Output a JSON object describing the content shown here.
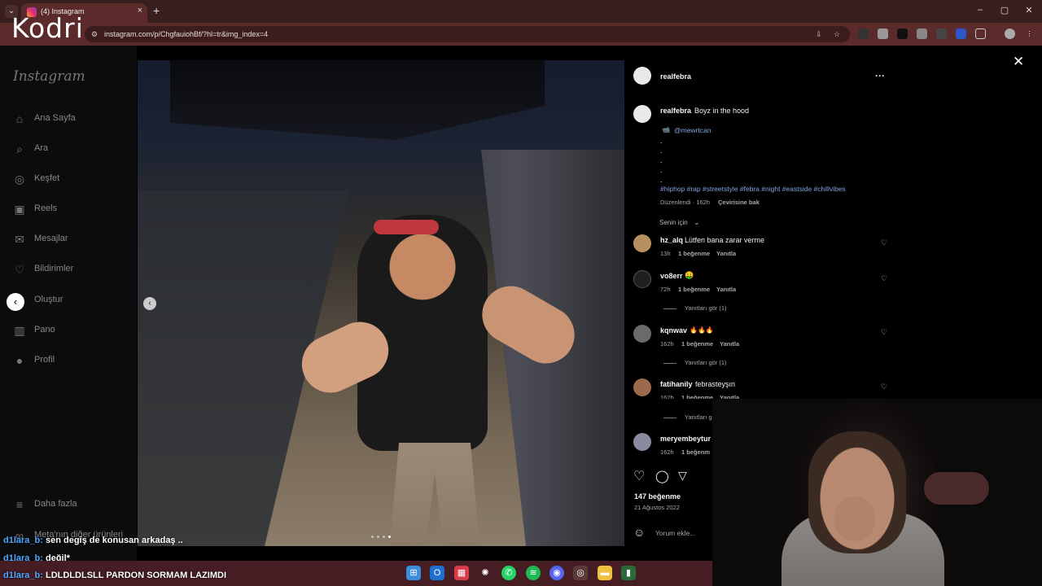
{
  "browser": {
    "tab_title": "(4) Instagram",
    "tab_close": "×",
    "new_tab": "+",
    "url": "instagram.com/p/ChgfauiohBf/?hl=tr&img_index=4",
    "window_buttons": [
      "–",
      "▢",
      "✕"
    ]
  },
  "stream_brand": "Kodri",
  "sidebar": {
    "logo": "Instagram",
    "items": [
      {
        "label": "Ana Sayfa",
        "icon": "home-icon"
      },
      {
        "label": "Ara",
        "icon": "search-icon"
      },
      {
        "label": "Keşfet",
        "icon": "compass-icon"
      },
      {
        "label": "Reels",
        "icon": "reels-icon"
      },
      {
        "label": "Mesajlar",
        "icon": "messenger-icon"
      },
      {
        "label": "Bildirimler",
        "icon": "heart-icon"
      },
      {
        "label": "Oluştur",
        "icon": "plus-square-icon"
      },
      {
        "label": "Pano",
        "icon": "dashboard-icon"
      },
      {
        "label": "Profil",
        "icon": "profile-icon"
      }
    ],
    "more": "Daha fazla",
    "meta_more": "Meta'nın diğer ürünleri"
  },
  "post": {
    "author": "realfebra",
    "more_icon": "···",
    "caption_user": "realfebra",
    "caption_text": "Boyz in the hood",
    "camera_emoji": "📹",
    "credit": "@mewrtcan",
    "hashtags": "#hiphop #rap #streetstyle #febra #night #eastside #chillvibes",
    "edited_time": "Düzenlendi · 162h",
    "translate": "Çevirisine bak",
    "filter": "Senin için",
    "likes": "147 beğenme",
    "date": "21 Ağustos 2022",
    "add_comment": "Yorum ekle..."
  },
  "comments": [
    {
      "user": "hz_alq",
      "text": "Lütfen bana zarar verme",
      "time": "13h",
      "likes": "1 beğenme",
      "reply": "Yanıtla",
      "view_replies": ""
    },
    {
      "user": "vo8err",
      "text": "🤑",
      "time": "72h",
      "likes": "1 beğenme",
      "reply": "Yanıtla",
      "view_replies": "Yanıtları gör (1)"
    },
    {
      "user": "kqnwav",
      "text": "🔥🔥🔥",
      "time": "162h",
      "likes": "1 beğenme",
      "reply": "Yanıtla",
      "view_replies": "Yanıtları gör (1)"
    },
    {
      "user": "fatihanily",
      "text": "febrasteyşın",
      "time": "162h",
      "likes": "1 beğenme",
      "reply": "Yanıtla",
      "view_replies": "Yanıtları g"
    },
    {
      "user": "meryembeytur",
      "text": "",
      "time": "162h",
      "likes": "1 beğenm",
      "reply": "",
      "view_replies": ""
    }
  ],
  "chat": [
    {
      "user": "d1lara_b:",
      "msg": "sen degiş de konusan arkadaş .."
    },
    {
      "user": "d1lara_b:",
      "msg": "değil*"
    },
    {
      "user": "d1lara_b:",
      "msg": "LDLDLDLSLL PARDON SORMAM LAZIMDI"
    }
  ]
}
